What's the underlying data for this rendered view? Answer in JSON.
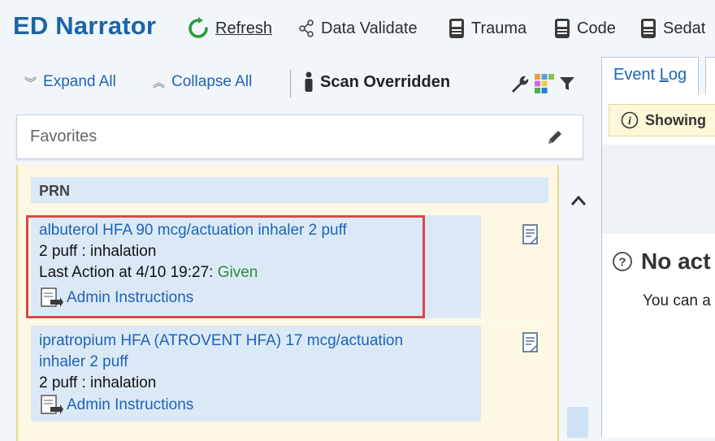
{
  "app_title": "ED Narrator",
  "toolbar": {
    "refresh_label": "Refresh",
    "data_validate_label": "Data Validate",
    "trauma_label": "Trauma",
    "code_label": "Code",
    "sedation_label": "Sedat"
  },
  "actions": {
    "expand_all": "Expand All",
    "collapse_all": "Collapse All",
    "scan_overridden": "Scan Overridden"
  },
  "favorites": {
    "label": "Favorites"
  },
  "prn": {
    "header": "PRN",
    "items": [
      {
        "name": "albuterol HFA 90 mcg/actuation inhaler 2 puff",
        "dose_route": "2 puff  :  inhalation",
        "last_action_prefix": "Last Action at 4/10 19:27: ",
        "last_action_status": "Given",
        "admin_label": "Admin Instructions"
      },
      {
        "name_line1": "ipratropium HFA (ATROVENT HFA) 17 mcg/actuation",
        "name_line2": "inhaler 2 puff",
        "dose_route": "2 puff  :  inhalation",
        "admin_label": "Admin Instructions"
      }
    ]
  },
  "right_pane": {
    "tab_event_log_prefix": "Event ",
    "tab_event_log_underlined": "L",
    "tab_event_log_suffix": "og",
    "banner_text": "Showing",
    "no_activity": "No act",
    "you_can": "You can a"
  },
  "colors": {
    "title_blue": "#1b64a8",
    "link_blue": "#1f63b5",
    "given_green": "#2e8a3a",
    "highlight_red": "#d84a4a",
    "panel_yellow": "#fcf8e3",
    "item_blue": "#dbe9f7"
  },
  "icons": {
    "refresh": "refresh-icon",
    "data_validate": "share-nodes-icon",
    "trauma": "printer-icon",
    "code": "printer-icon",
    "sedation": "printer-icon",
    "scan": "person-icon",
    "wrench": "wrench-icon",
    "grid": "color-grid-icon",
    "filter": "filter-icon",
    "edit": "pencil-icon",
    "document": "document-icon",
    "admin": "admin-instructions-icon",
    "scroll_up": "chevron-up-icon",
    "info": "info-icon",
    "help": "question-icon"
  }
}
